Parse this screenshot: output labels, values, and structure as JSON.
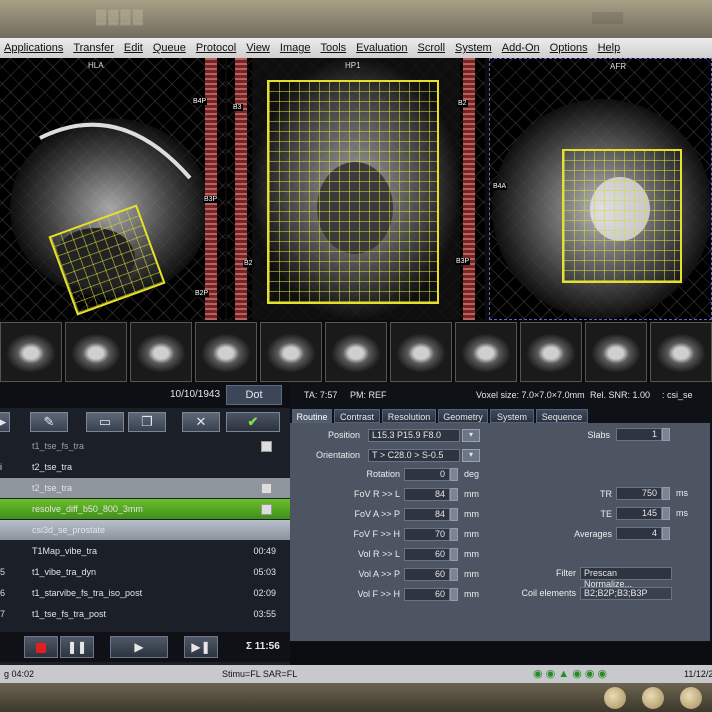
{
  "menu": [
    "Applications",
    "Transfer",
    "Edit",
    "Queue",
    "Protocol",
    "View",
    "Image",
    "Tools",
    "Evaluation",
    "Scroll",
    "System",
    "Add-On",
    "Options",
    "Help"
  ],
  "viewers": {
    "sag_label": "HLA",
    "cor_label": "HP1",
    "tra_label": "AFR",
    "sat_labels": [
      "B4P",
      "B3P",
      "B2P",
      "B3",
      "B2",
      "B2",
      "B3P",
      "B4A"
    ]
  },
  "exam": {
    "date": "10/10/1943",
    "patient_btn": "Dot"
  },
  "queue": [
    {
      "num": "",
      "name": "t1_tse_fs_tra",
      "time": "",
      "state": "dim"
    },
    {
      "num": "i",
      "name": "t2_tse_tra",
      "time": "",
      "state": "normal"
    },
    {
      "num": "",
      "name": "t2_tse_tra",
      "time": "",
      "state": "done"
    },
    {
      "num": "",
      "name": "resolve_diff_b50_800_3mm",
      "time": "",
      "state": "green"
    },
    {
      "num": "",
      "name": "csi3d_se_prostate",
      "time": "",
      "state": "cur"
    },
    {
      "num": "",
      "name": "T1Map_vibe_tra",
      "time": "00:49",
      "state": "normal"
    },
    {
      "num": "5",
      "name": "t1_vibe_tra_dyn",
      "time": "05:03",
      "state": "normal"
    },
    {
      "num": "6",
      "name": "t1_starvibe_fs_tra_iso_post",
      "time": "02:09",
      "state": "normal"
    },
    {
      "num": "7",
      "name": "t1_tse_fs_tra_post",
      "time": "03:55",
      "state": "normal"
    }
  ],
  "total_time": "Σ 11:56",
  "header": {
    "ta": "TA: 7:57",
    "pm": "PM: REF",
    "voxel": "Voxel size: 7.0×7.0×7.0mm",
    "snr": "Rel. SNR: 1.00",
    "seq": ": csi_se"
  },
  "tabs": [
    "Routine",
    "Contrast",
    "Resolution",
    "Geometry",
    "System",
    "Sequence"
  ],
  "params": {
    "position_label": "Position",
    "position": "L15.3 P15.9 F8.0",
    "orientation_label": "Orientation",
    "orientation": "T > C28.0 > S-0.5",
    "rotation_label": "Rotation",
    "rotation": "0",
    "rotation_unit": "deg",
    "fov_rl_label": "FoV R >> L",
    "fov_rl": "84",
    "fov_ap_label": "FoV A >> P",
    "fov_ap": "84",
    "fov_fh_label": "FoV F >> H",
    "fov_fh": "70",
    "vol_rl_label": "Vol R >> L",
    "vol_rl": "60",
    "vol_ap_label": "Vol A >> P",
    "vol_ap": "60",
    "vol_fh_label": "Vol F >> H",
    "vol_fh": "60",
    "mm": "mm",
    "slabs_label": "Slabs",
    "slabs": "1",
    "tr_label": "TR",
    "tr": "750",
    "te_label": "TE",
    "te": "145",
    "ms": "ms",
    "averages_label": "Averages",
    "averages": "4",
    "filter_label": "Filter",
    "filter": "Prescan Normalize...",
    "coil_label": "Coil elements",
    "coil": "B2;B2P;B3;B3P"
  },
  "status": {
    "left": "g 04:02",
    "mid": "Stimu=FL SAR=FL",
    "right": "11/12/2"
  }
}
